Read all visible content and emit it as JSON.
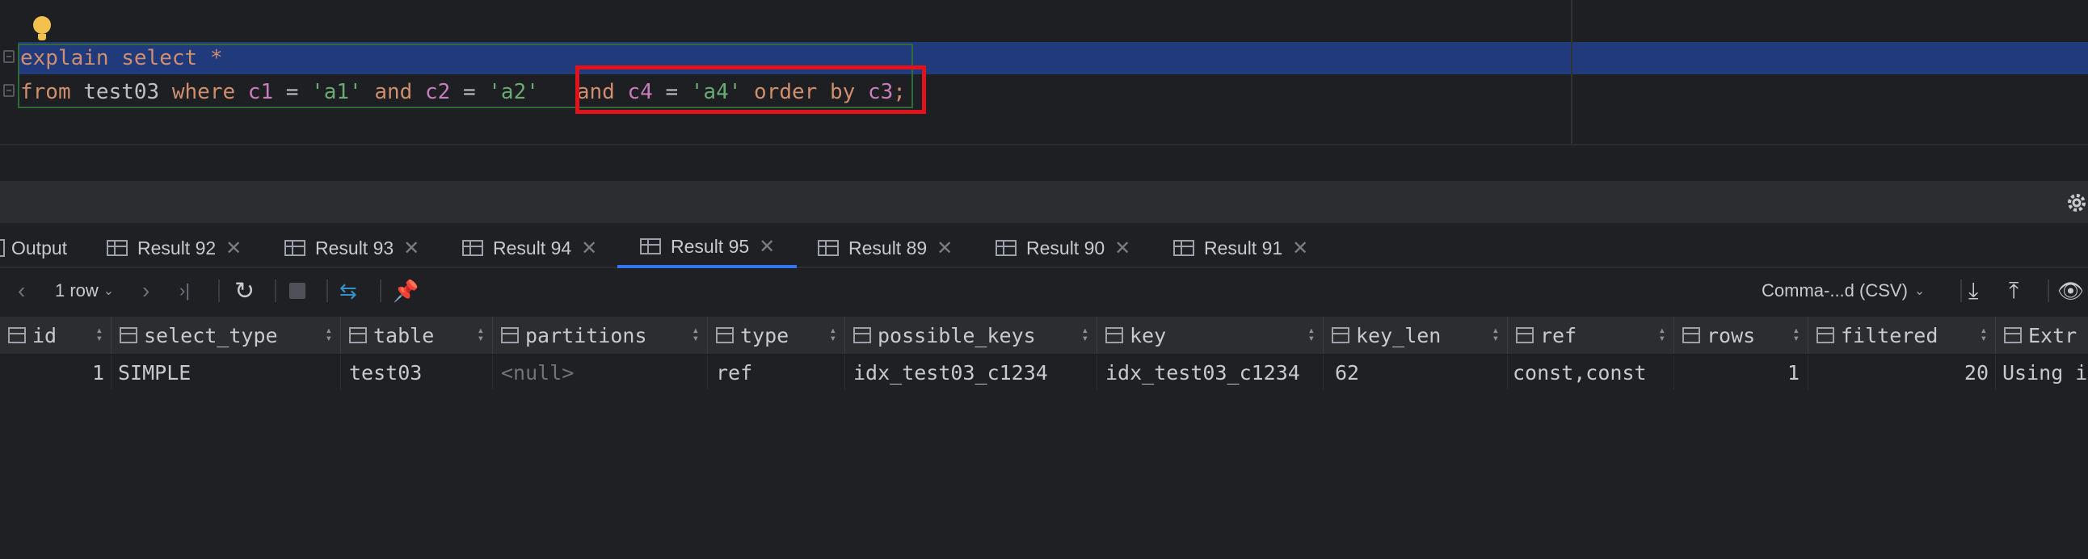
{
  "editor": {
    "line1": {
      "kw1": "explain",
      "kw2": "select",
      "star": "*"
    },
    "line2": {
      "from": "from",
      "table": "test03",
      "where": "where",
      "c1": "c1",
      "eq1": "=",
      "v1": "'a1'",
      "and1": "and",
      "c2": "c2",
      "eq2": "=",
      "v2": "'a2'",
      "and2": "and",
      "c4": "c4",
      "eq3": "=",
      "v4": "'a4'",
      "order": "order",
      "by": "by",
      "c3": "c3",
      "semi": ";"
    }
  },
  "tabs": [
    {
      "label": "Output"
    },
    {
      "label": "Result 92"
    },
    {
      "label": "Result 93"
    },
    {
      "label": "Result 94"
    },
    {
      "label": "Result 95",
      "active": true
    },
    {
      "label": "Result 89"
    },
    {
      "label": "Result 90"
    },
    {
      "label": "Result 91"
    }
  ],
  "toolbar": {
    "row_count": "1 row",
    "export_format": "Comma-...d (CSV)"
  },
  "grid": {
    "columns": [
      "id",
      "select_type",
      "table",
      "partitions",
      "type",
      "possible_keys",
      "key",
      "key_len",
      "ref",
      "rows",
      "filtered",
      "Extr"
    ],
    "row": [
      "1",
      "SIMPLE",
      "test03",
      "<null>",
      "ref",
      "idx_test03_c1234",
      "idx_test03_c1234",
      "62",
      "const,const",
      "1",
      "20",
      "Using i"
    ]
  },
  "colors": {
    "accent": "#3574f0",
    "highlight_box": "#e0121b",
    "keyword": "#cf8e6d",
    "column": "#c77dbb",
    "string": "#6aab73"
  }
}
